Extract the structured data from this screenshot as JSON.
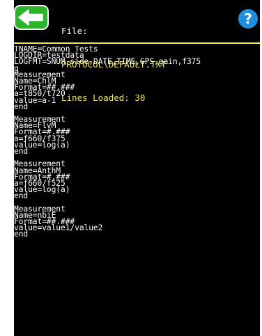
{
  "header": {
    "back_icon": "back-arrow-icon",
    "file_label": "File:",
    "file_path": "PROTOCOL\\DEFAULT.TXT",
    "lines_loaded": "Lines Loaded: 30",
    "help_icon": "help-icon",
    "help_glyph": "?"
  },
  "colors": {
    "background": "#000000",
    "text": "#ffffff",
    "accent": "#f2e94a",
    "back_button": "#2bb52b",
    "help_button": "#1e8fe0"
  },
  "lines": [
    "TNAME=Common Tests",
    "LOGDIR=testdata",
    "LOGFMT=SNUM,side,DATE,TIME,GPS,gain,f375",
    "g",
    "Measurement",
    "Name=ChlM",
    "Format=##.###",
    "a=t850/t720",
    "value=a-1",
    "end",
    "",
    "Measurement",
    "Name=FlvM",
    "Format=#.###",
    "a=f660/f375",
    "value=log(a)",
    "end",
    "",
    "Measurement",
    "Name=AnthM",
    "Format=#.###",
    "a=f660/f525",
    "value=log(a)",
    "end",
    "",
    "Measurement",
    "Name=nbiE",
    "Format=##.###",
    "value=value1/value2",
    "end"
  ]
}
